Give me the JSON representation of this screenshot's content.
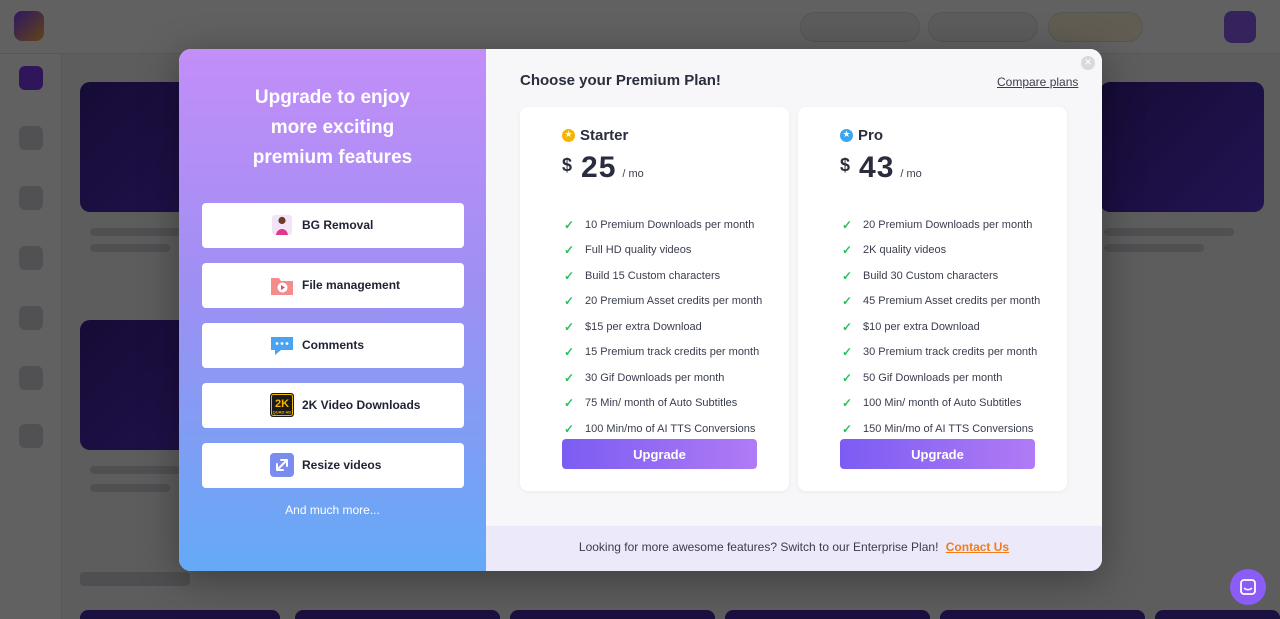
{
  "modal": {
    "left": {
      "title_lines": [
        "Upgrade to enjoy",
        "more exciting",
        "premium features"
      ],
      "features": [
        {
          "label": "BG Removal",
          "icon": "person-cutout-icon"
        },
        {
          "label": "File management",
          "icon": "folder-play-icon"
        },
        {
          "label": "Comments",
          "icon": "chat-bubble-icon"
        },
        {
          "label": "2K Video Downloads",
          "icon": "2k-quad-hd-icon",
          "icon_text": "2K",
          "icon_subtext": "QUAD HD"
        },
        {
          "label": "Resize videos",
          "icon": "resize-arrows-icon"
        }
      ],
      "and_more": "And much more..."
    },
    "heading": "Choose your Premium Plan!",
    "compare_link": "Compare plans",
    "plans": [
      {
        "name": "Starter",
        "currency": "$",
        "price": "25",
        "period": "/ mo",
        "icon": "star-badge-icon",
        "icon_color": "#f5b400",
        "features": [
          "10 Premium Downloads per month",
          "Full HD quality videos",
          "Build 15 Custom characters",
          "20 Premium Asset credits per month",
          "$15 per extra Download",
          "15 Premium track credits per month",
          "30 Gif Downloads per month",
          "75 Min/ month of Auto Subtitles",
          "100 Min/mo of AI TTS Conversions"
        ],
        "button": "Upgrade"
      },
      {
        "name": "Pro",
        "currency": "$",
        "price": "43",
        "period": "/ mo",
        "icon": "star-badge-icon",
        "icon_color": "#3aa6f0",
        "features": [
          "20 Premium Downloads per month",
          "2K quality videos",
          "Build 30 Custom characters",
          "45 Premium Asset credits per month",
          "$10 per extra Download",
          "30 Premium track credits per month",
          "50 Gif Downloads per month",
          "100 Min/ month of Auto Subtitles",
          "150 Min/mo of AI TTS Conversions"
        ],
        "button": "Upgrade"
      }
    ],
    "footer": {
      "text": "Looking for more awesome features? Switch to our Enterprise Plan!",
      "link": "Contact Us"
    }
  },
  "colors": {
    "accent_purple": "#7b5cf3",
    "check_green": "#28c25a",
    "link_orange": "#f07d1a"
  }
}
